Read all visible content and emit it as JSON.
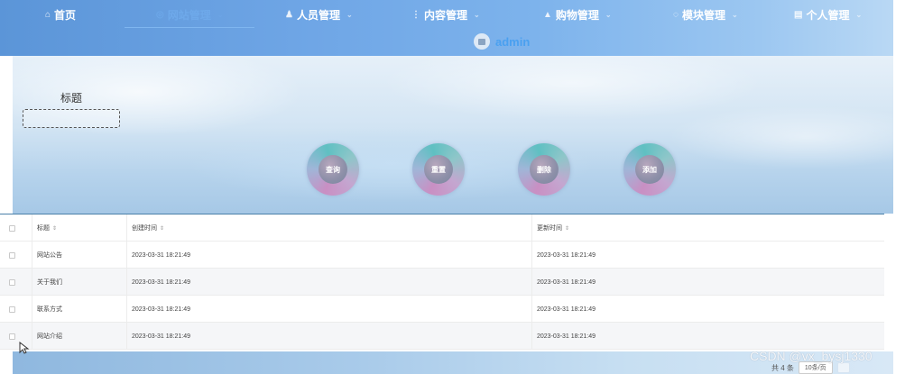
{
  "nav": {
    "items": [
      {
        "label": "首页",
        "icon": "home-icon",
        "glyph": "⌂",
        "has_dropdown": false,
        "active": false
      },
      {
        "label": "网站管理",
        "icon": "site-icon",
        "glyph": "◎",
        "has_dropdown": true,
        "active": true
      },
      {
        "label": "人员管理",
        "icon": "user-icon",
        "glyph": "♟",
        "has_dropdown": true,
        "active": false
      },
      {
        "label": "内容管理",
        "icon": "content-icon",
        "glyph": "⋮",
        "has_dropdown": true,
        "active": false
      },
      {
        "label": "购物管理",
        "icon": "shopping-icon",
        "glyph": "▲",
        "has_dropdown": true,
        "active": false
      },
      {
        "label": "模块管理",
        "icon": "module-icon",
        "glyph": "◌",
        "has_dropdown": true,
        "active": false
      },
      {
        "label": "个人管理",
        "icon": "profile-icon",
        "glyph": "▤",
        "has_dropdown": true,
        "active": false
      }
    ],
    "chevron": "⌄",
    "user": {
      "name": "admin",
      "avatar_icon": "avatar-image-icon"
    }
  },
  "search": {
    "label": "标题",
    "input_value": "",
    "placeholder": "",
    "buttons": [
      {
        "label": "查询",
        "action": "query"
      },
      {
        "label": "重置",
        "action": "reset"
      },
      {
        "label": "删除",
        "action": "delete"
      },
      {
        "label": "添加",
        "action": "add"
      }
    ]
  },
  "table": {
    "columns": [
      "标题",
      "创建时间",
      "更新时间"
    ],
    "sort_icon": "⇕",
    "rows": [
      {
        "title": "网站公告",
        "created": "2023-03-31 18:21:49",
        "updated": "2023-03-31 18:21:49"
      },
      {
        "title": "关于我们",
        "created": "2023-03-31 18:21:49",
        "updated": "2023-03-31 18:21:49"
      },
      {
        "title": "联系方式",
        "created": "2023-03-31 18:21:49",
        "updated": "2023-03-31 18:21:49"
      },
      {
        "title": "网站介绍",
        "created": "2023-03-31 18:21:49",
        "updated": "2023-03-31 18:21:49"
      }
    ]
  },
  "pagination": {
    "total_text": "共 4 条",
    "page_size": "10条/页"
  },
  "watermark": "CSDN @vx_bysj1330",
  "colors": {
    "nav_active": "#6ea9ea",
    "username": "#4aa0f0",
    "table_border": "#4a7fa8"
  }
}
